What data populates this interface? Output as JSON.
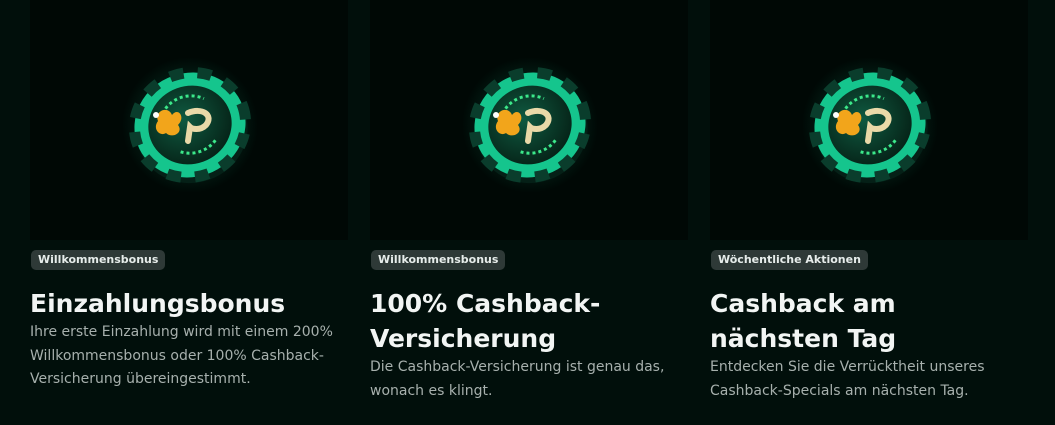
{
  "colors": {
    "background": "#010f0b",
    "thumbnail_background": "#000805",
    "badge_background": "#2e3937",
    "chip_green": "#15c58d",
    "chip_dark": "#0a3d2c",
    "logo_gold": "#f2a51b",
    "title_text": "#f2f5f4",
    "description_text": "#a7b0ad"
  },
  "icons": {
    "thumbnail": "casino-chip-icon"
  },
  "promotions": [
    {
      "badge": "Willkommensbonus",
      "title": "Einzahlungsbonus",
      "description": "Ihre erste Einzahlung wird mit einem 200% Willkommensbonus oder 100% Cashback-Versicherung übereingestimmt."
    },
    {
      "badge": "Willkommensbonus",
      "title": "100% Cashback-Versicherung",
      "description": "Die Cashback-Versicherung ist genau das, wonach es klingt."
    },
    {
      "badge": "Wöchentliche Aktionen",
      "title": "Cashback am nächsten Tag",
      "description": "Entdecken Sie die Verrücktheit unseres Cashback-Specials am nächsten Tag."
    }
  ]
}
